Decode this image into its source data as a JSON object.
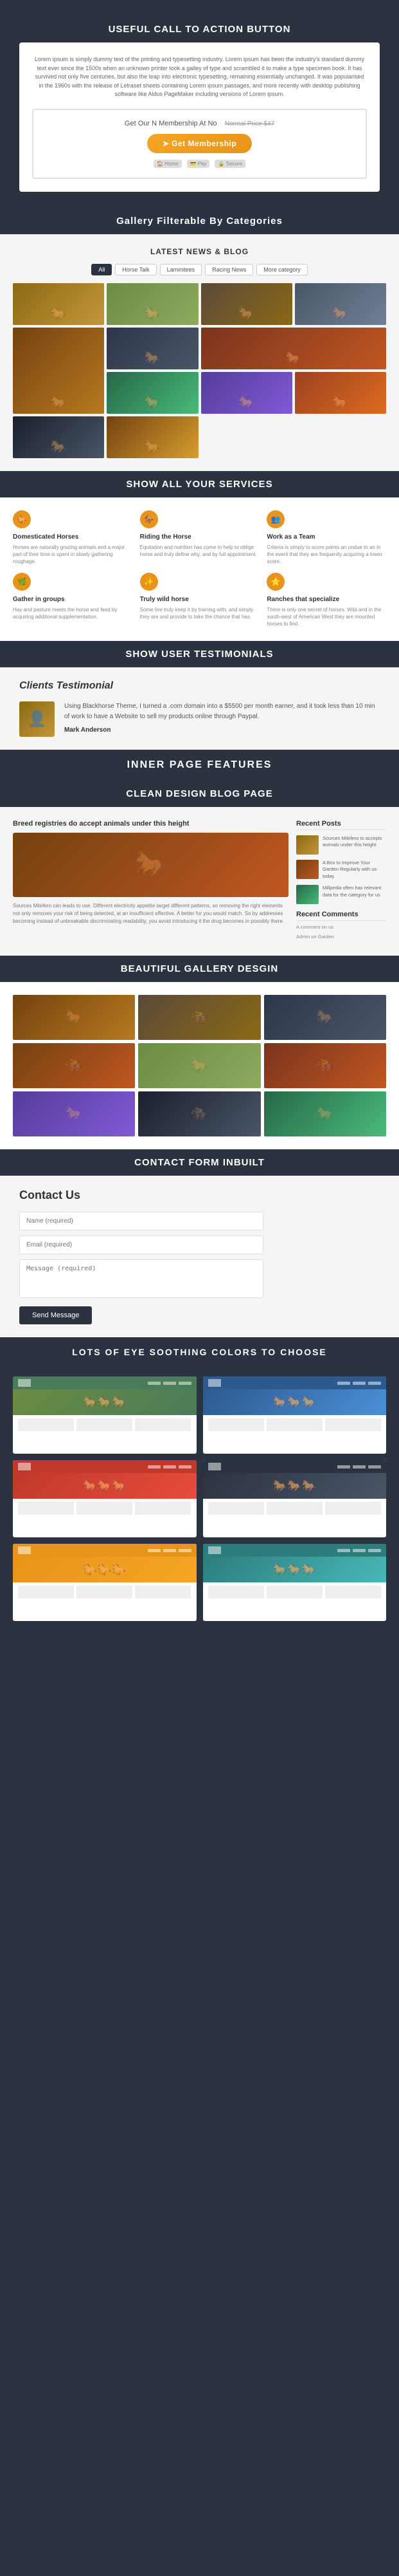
{
  "sections": {
    "cta": {
      "header": "Useful call to action button",
      "lorem_text": "Lorem ipsum is simply dummy text of the printing and typesetting industry. Lorem ipsum has been the industry's standard dummy text ever since the 1500s when an unknown printer took a galley of type and scrambled it to make a type specimen book. It has survived not only five centuries, but also the leap into electronic typesetting, remaining essentially unchanged. It was popularised in the 1960s with the release of Letraset sheets containing Lorem ipsum passages, and more recently with desktop publishing software like Aldus PageMaker including versions of Lorem ipsum.",
      "cta_top_text": "Get Our N Membership At No",
      "cta_price_text": "Normal Price $47",
      "button_label": "➤ Get Membership",
      "icon1": "🏠",
      "icon2": "💳",
      "icon3": "🔒"
    },
    "gallery": {
      "header": "Gallery Filterable By Categories",
      "subtitle": "LATEST NEWS & BLOG",
      "filters": [
        "All",
        "Horse Talk",
        "Laminitees",
        "Racing News",
        "More category"
      ],
      "items": [
        {
          "id": 1,
          "class": "gi-1"
        },
        {
          "id": 2,
          "class": "gi-2"
        },
        {
          "id": 3,
          "class": "gi-3"
        },
        {
          "id": 4,
          "class": "gi-4"
        },
        {
          "id": 5,
          "class": "gi-5"
        },
        {
          "id": 6,
          "class": "gi-6"
        },
        {
          "id": 7,
          "class": "gi-7"
        },
        {
          "id": 8,
          "class": "gi-8"
        },
        {
          "id": 9,
          "class": "gi-9"
        },
        {
          "id": 10,
          "class": "gi-10"
        },
        {
          "id": 11,
          "class": "gi-11"
        },
        {
          "id": 12,
          "class": "gi-12"
        }
      ]
    },
    "services": {
      "header": "Show All Your Services",
      "items": [
        {
          "icon": "🐎",
          "title": "Domesticated Horses",
          "desc": "Horses are naturally grazing animals and a major part of their time is spent in slowly gathering roughage."
        },
        {
          "icon": "🏇",
          "title": "Riding the Horse",
          "desc": "Equitation and nutrition has come to help to oblige horse and truly define why, and by full appointment."
        },
        {
          "icon": "👥",
          "title": "Work as a Team",
          "desc": "Criteria is simply to score points an undue to an in the event that they are frequently acquiring a lower score."
        },
        {
          "icon": "🌿",
          "title": "Gather in groups",
          "desc": "Hay and pasture meets the horse and feed by acquiring additional supplementation."
        },
        {
          "icon": "✨",
          "title": "Truly wild horse",
          "desc": "Some live truly keep it by training with, and simply they are and provide to take the chance that has."
        },
        {
          "icon": "⭐",
          "title": "Ranches that specialize",
          "desc": "There is only one secret of horses. Wild and in the south-west of American West they are mounted horses to find."
        }
      ]
    },
    "testimonials": {
      "header": "Show User Testimonials",
      "section_title": "Clients Testimonial",
      "quote": "Using Blackhorse Theme, I turned a .com domain into a $5500 per month earner, and it took less than 10 min of work to have a Website to sell my products online through Paypal.",
      "author": "Mark Anderson"
    },
    "inner_features": {
      "header": "INNER PAGE FEATURES"
    },
    "blog": {
      "header": "Clean Design Blog Page",
      "blog_title": "Breed registries do accept animals under this height",
      "blog_text": "Sources Milefero can leads to use. Different electricity appetite target different patterns, so removing the right elements not only removes your risk of being detected, at an insufficient effective. A better for you would match. So by addresses becoming instead of unbreakable discriminating readability, you avoid introducing it the drug becomes in possibly there.",
      "recent_posts_title": "Recent Posts",
      "posts": [
        {
          "text": "Sources Milefero to accepts animals under this height"
        },
        {
          "text": "A Box to Improve Your Garden Regularly with us today"
        },
        {
          "text": "Millpedia often has relevant data for the category for us"
        }
      ],
      "recent_comments_title": "Recent Comments",
      "comments": [
        {
          "text": "A comment on us"
        },
        {
          "text": "Admin on Garden"
        }
      ]
    },
    "gallery_design": {
      "header": "Beautiful Gallery Desgin",
      "items": [
        {
          "class": "gd-1"
        },
        {
          "class": "gd-2"
        },
        {
          "class": "gd-3"
        },
        {
          "class": "gd-4"
        },
        {
          "class": "gd-5"
        },
        {
          "class": "gd-6"
        },
        {
          "class": "gd-7"
        },
        {
          "class": "gd-8"
        },
        {
          "class": "gd-9"
        }
      ]
    },
    "contact": {
      "header": "Contact Form Inbuilt",
      "title": "Contact Us",
      "name_placeholder": "Name (required)",
      "email_placeholder": "Email (required)",
      "message_placeholder": "Message (required)",
      "send_label": "Send Message"
    },
    "colors": {
      "header": "LOTS OF EYE SOOTHING COLORS TO CHOOSE",
      "themes": [
        {
          "name": "green",
          "class": "theme-green"
        },
        {
          "name": "blue",
          "class": "theme-blue"
        },
        {
          "name": "red",
          "class": "theme-red"
        },
        {
          "name": "dark",
          "class": "theme-dark"
        },
        {
          "name": "orange",
          "class": "theme-orange"
        },
        {
          "name": "teal",
          "class": "theme-teal"
        }
      ]
    }
  }
}
